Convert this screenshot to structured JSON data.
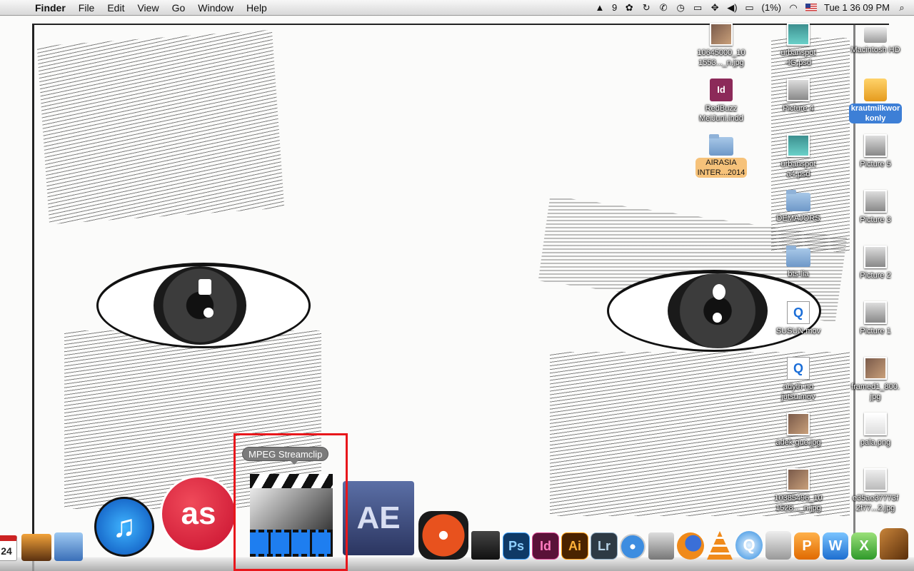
{
  "menubar": {
    "app_name": "Finder",
    "menus": [
      "File",
      "Edit",
      "View",
      "Go",
      "Window",
      "Help"
    ],
    "adobe_count": "9",
    "battery": "(1%)",
    "clock": "Tue 1 36 09 PM"
  },
  "desktop_icons": [
    {
      "label": "10645000_10\n1553..._n.jpg",
      "kind": "image"
    },
    {
      "label": "urbanspot\n-IG.psd",
      "kind": "psd"
    },
    {
      "label": "Macintosh HD",
      "kind": "disk"
    },
    {
      "label": "RedBuzz\nMeiJuni.indd",
      "kind": "indd"
    },
    {
      "label": "Picture 4",
      "kind": "screenshot"
    },
    {
      "label": "krautmilkwor\nkonly",
      "kind": "usb",
      "selected": true
    },
    {
      "label": "AIRASIA\nINTER...2014",
      "kind": "folder",
      "tag": "orange"
    },
    {
      "label": "urbanspot\na4.psd",
      "kind": "psd"
    },
    {
      "label": "Picture 5",
      "kind": "screenshot"
    },
    {
      "label": "DEMAJORS",
      "kind": "folder"
    },
    {
      "label": "Picture 3",
      "kind": "screenshot"
    },
    {
      "label": "bts-lia",
      "kind": "folder"
    },
    {
      "label": "Picture 2",
      "kind": "screenshot"
    },
    {
      "label": "SUSUN.mov",
      "kind": "movie"
    },
    {
      "label": "Picture 1",
      "kind": "screenshot"
    },
    {
      "label": "adyth no\njutsu.mov",
      "kind": "movie"
    },
    {
      "label": "framed1_800.\njpg",
      "kind": "image"
    },
    {
      "label": "adek gue.jpg",
      "kind": "image"
    },
    {
      "label": "pala.png",
      "kind": "image"
    },
    {
      "label": "10385496_10\n1528..._n.jpg",
      "kind": "image"
    },
    {
      "label": "e35ae37773f\n2f77...2.jpg",
      "kind": "image"
    }
  ],
  "dock": {
    "tooltip": "MPEG Streamclip",
    "calendar_day": "24",
    "apps": [
      {
        "name": "ical-icon",
        "text": ""
      },
      {
        "name": "iphoto-icon",
        "text": ""
      },
      {
        "name": "mail-icon",
        "text": ""
      },
      {
        "name": "itunes-icon",
        "text": "♫"
      },
      {
        "name": "lastfm-icon",
        "text": "as"
      },
      {
        "name": "mpeg-streamclip-icon",
        "text": ""
      },
      {
        "name": "after-effects-icon",
        "text": "AE"
      },
      {
        "name": "reason-icon",
        "text": ""
      },
      {
        "name": "final-cut-icon",
        "text": ""
      },
      {
        "name": "photoshop-icon",
        "text": "Ps"
      },
      {
        "name": "indesign-icon",
        "text": "Id"
      },
      {
        "name": "illustrator-icon",
        "text": "Ai"
      },
      {
        "name": "lightroom-icon",
        "text": "Lr"
      },
      {
        "name": "safari-icon",
        "text": ""
      },
      {
        "name": "image-capture-icon",
        "text": ""
      },
      {
        "name": "firefox-icon",
        "text": ""
      },
      {
        "name": "vlc-icon",
        "text": ""
      },
      {
        "name": "quicktime-icon",
        "text": "Q"
      },
      {
        "name": "utility-icon",
        "text": ""
      },
      {
        "name": "powerpoint-icon",
        "text": "P"
      },
      {
        "name": "word-icon",
        "text": "W"
      },
      {
        "name": "excel-icon",
        "text": "X"
      },
      {
        "name": "garageband-icon",
        "text": ""
      }
    ]
  },
  "colors": {
    "highlight_border": "#e8161b",
    "selection": "#3d7fd6",
    "tag_orange": "#f6c27a"
  }
}
